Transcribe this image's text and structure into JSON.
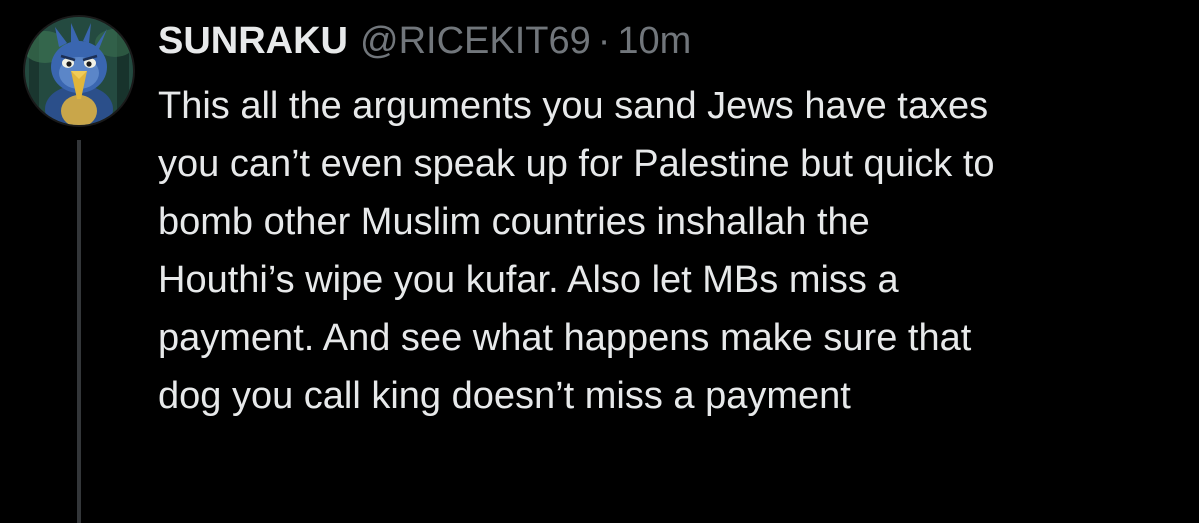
{
  "post": {
    "author": {
      "display_name": "SUNRAKU",
      "handle": "@RICEKIT69",
      "avatar_icon": "blue-bird-character-icon"
    },
    "separator": "·",
    "timestamp": "10m",
    "text_lines": [
      "This all the arguments you sand Jews have taxes",
      "you can’t even speak up for Palestine but quick to",
      "bomb other Muslim countries inshallah the",
      "Houthi’s wipe you kufar. Also let MBs miss a",
      "payment. And see what happens make sure that",
      "dog you call king doesn’t miss a payment"
    ]
  },
  "theme": {
    "background": "#000000",
    "primary_text": "#e7e9ea",
    "secondary_text": "#71767b",
    "thread_line": "#333639"
  }
}
